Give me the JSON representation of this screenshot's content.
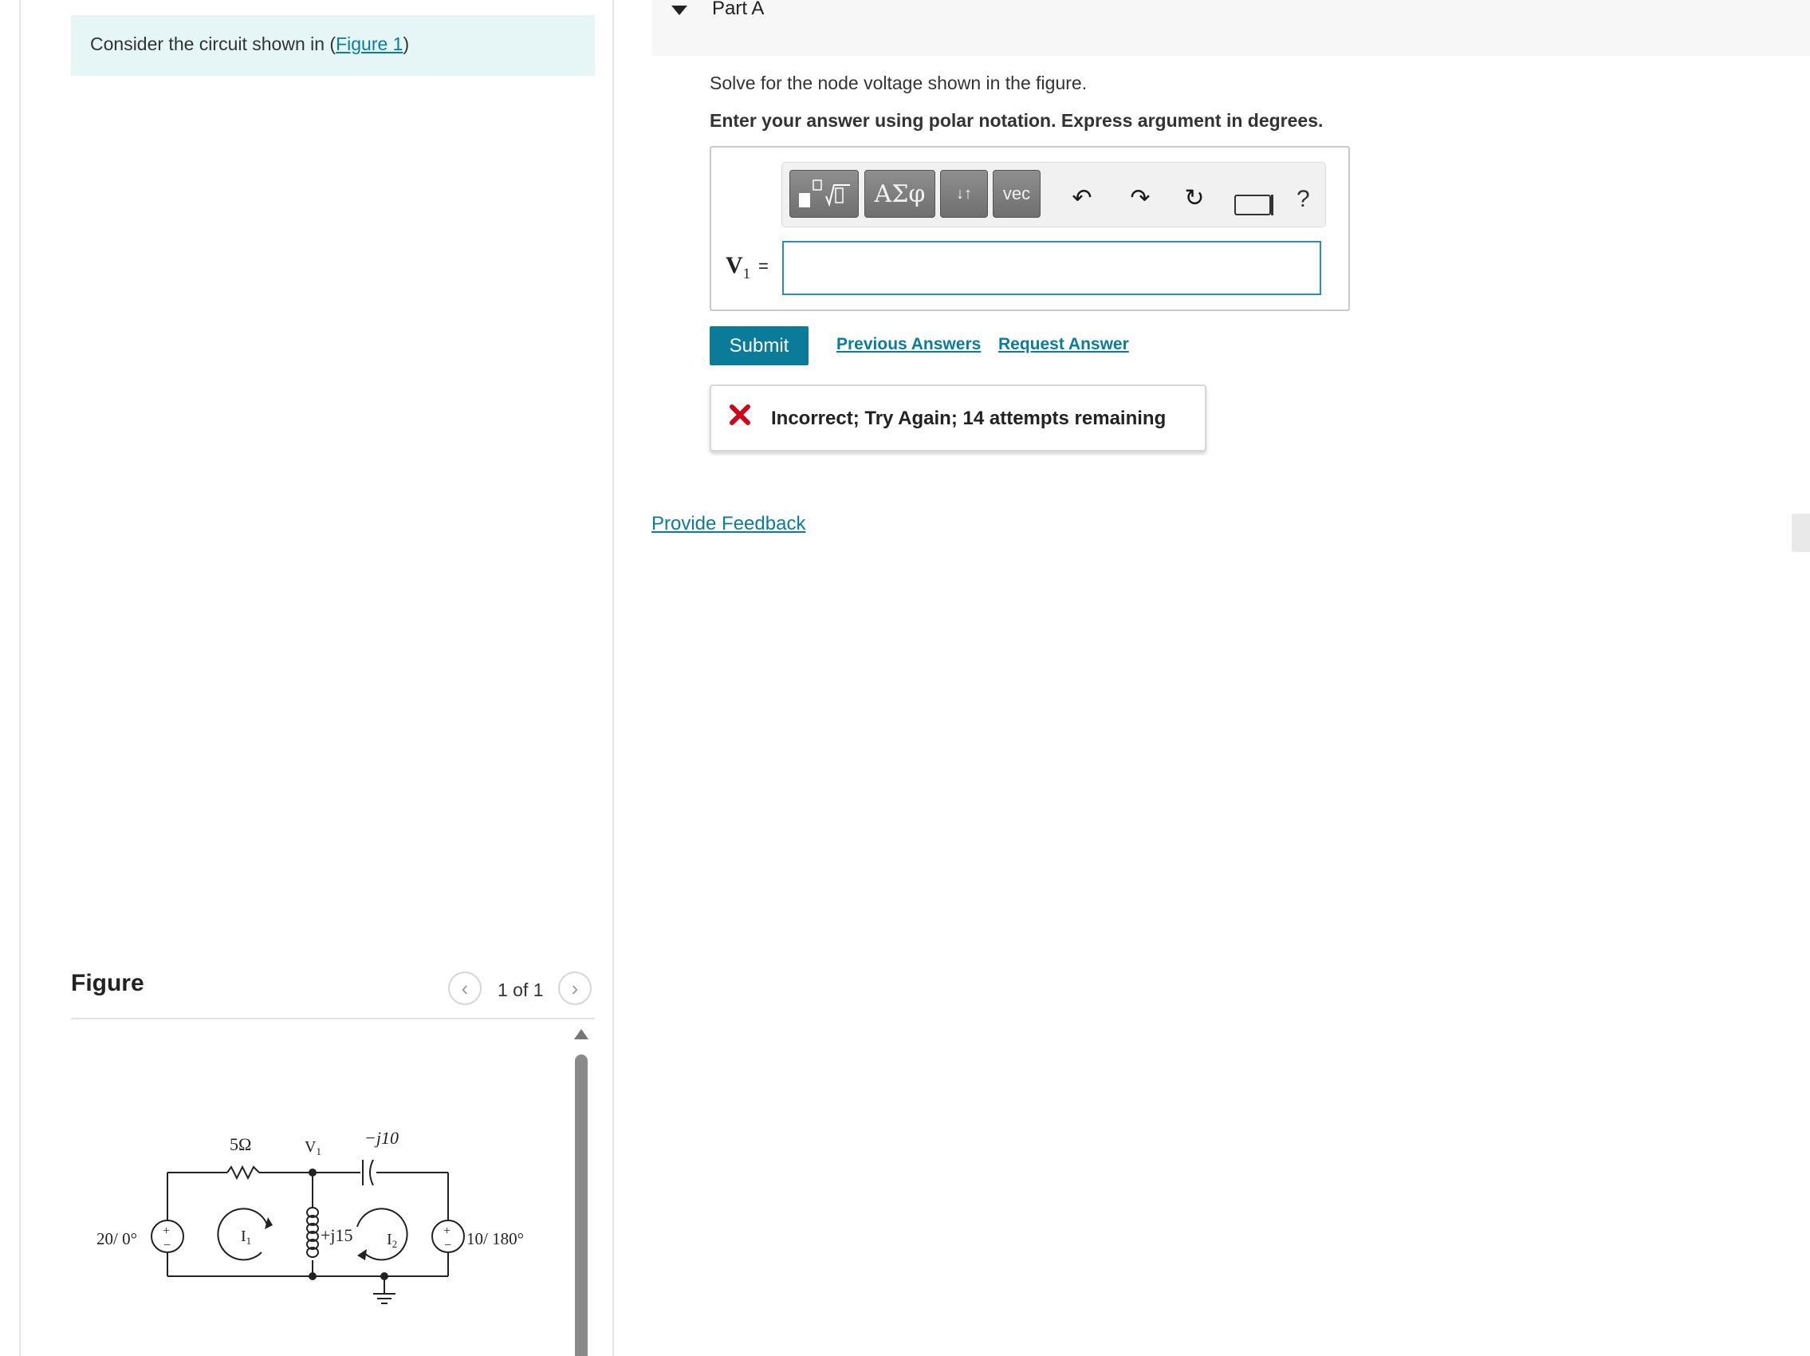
{
  "left": {
    "prompt_prefix": "Consider the circuit shown in (",
    "prompt_link": "Figure 1",
    "prompt_suffix": ")",
    "figure_heading": "Figure",
    "figure_count": "1 of 1",
    "nav_prev_icon": "chevron-left-icon",
    "nav_next_icon": "chevron-right-icon",
    "circuit": {
      "resistor_label": "5Ω",
      "node_label": "V",
      "node_sub": "1",
      "capacitor_label": "−j10",
      "inductor_label": "+j15",
      "source1_label": "20/ 0°",
      "source2_label": "10/ 180°",
      "mesh1_label": "I",
      "mesh1_sub": "1",
      "mesh2_label": "I",
      "mesh2_sub": "2",
      "plus_sign": "+",
      "minus_sign": "−"
    }
  },
  "part": {
    "title": "Part A",
    "question": "Solve for the node voltage shown in the figure.",
    "instructions": "Enter your answer using polar notation. Express argument in degrees.",
    "variable_label": "V",
    "variable_sub": "1",
    "equals": "=",
    "input_value": "",
    "toolbar": {
      "greek_label": "ΑΣφ",
      "arrows_label": "↓↑",
      "vec_label": "vec",
      "help_label": "?",
      "undo_icon": "↶",
      "redo_icon": "↷",
      "reset_icon": "↻"
    },
    "submit_label": "Submit",
    "previous_answers_label": "Previous Answers",
    "request_answer_label": "Request Answer",
    "feedback_message": "Incorrect; Try Again; 14 attempts remaining",
    "provide_feedback_label": "Provide Feedback"
  },
  "colors": {
    "link": "#0a7ca0",
    "submit_bg": "#0a7c9a",
    "prompt_bg": "#e6f5f5",
    "error_red": "#d0021b"
  }
}
